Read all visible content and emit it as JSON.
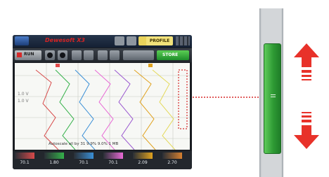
{
  "app": {
    "title": "Dewesoft X3",
    "profile_label": "PROFILE"
  },
  "toolbar": {
    "run_label": "RUN",
    "store_label": "STORE"
  },
  "scope": {
    "y_label_1": "1.0 V",
    "y_label_2": "1.0 V",
    "status_text": "Autoscale all by 31 9.9% 9.0% 1 MB"
  },
  "channels": [
    {
      "value": "70.1",
      "color": "#d84a4a"
    },
    {
      "value": "1.80",
      "color": "#35b14a"
    },
    {
      "value": "70.1",
      "color": "#3a8fd6"
    },
    {
      "value": "70.1",
      "color": "#e86ad6"
    },
    {
      "value": "2.09",
      "color": "#e0a21f"
    },
    {
      "value": "2.70",
      "color": "#d68030"
    }
  ],
  "scrollbar": {
    "grip_icon": "grip-lines-icon"
  },
  "colors": {
    "thumb": "#2e9a34",
    "arrows": "#e8322a",
    "callout": "#d62a2a"
  }
}
